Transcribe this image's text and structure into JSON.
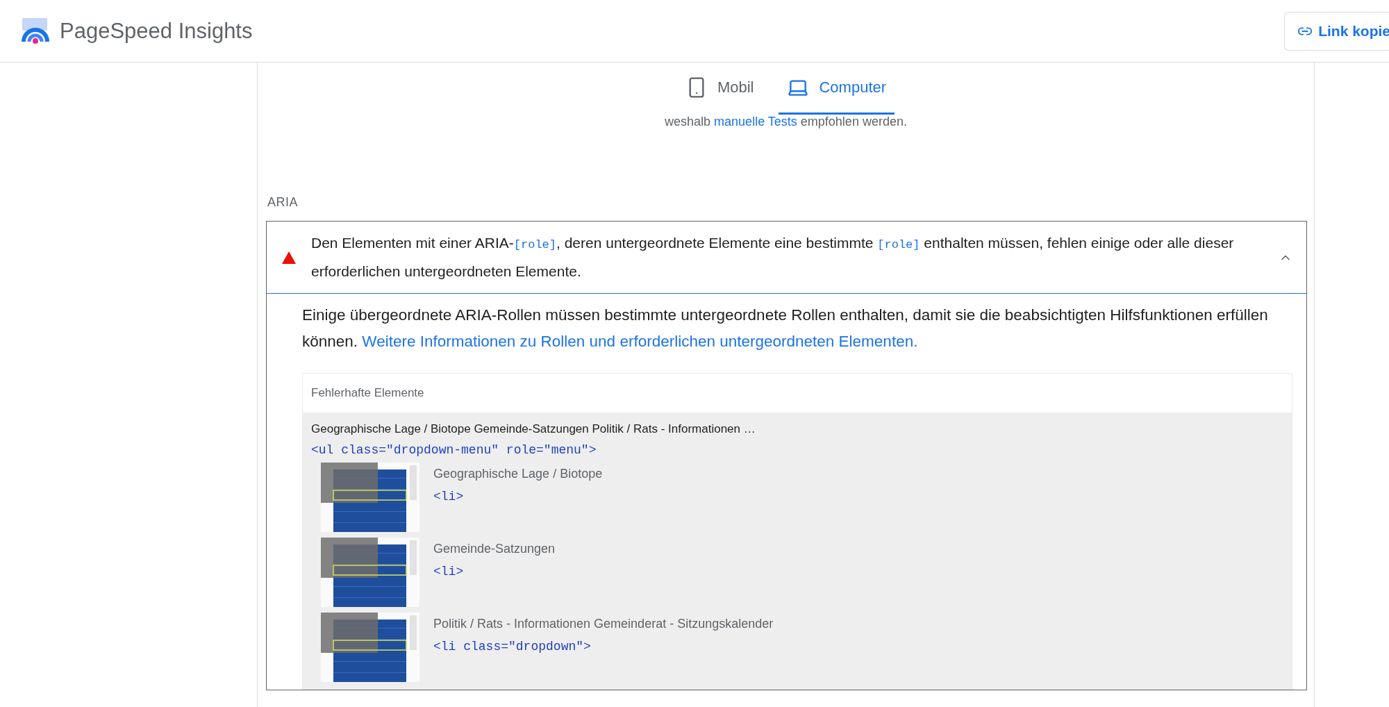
{
  "header": {
    "title": "PageSpeed Insights",
    "copy_link_button": "Link kopie"
  },
  "device_tabs": [
    {
      "label": "Mobil",
      "kind": "phone",
      "selected": false
    },
    {
      "label": "Computer",
      "kind": "laptop",
      "selected": true
    }
  ],
  "intro_text": {
    "before": "weshalb ",
    "link": "manuelle Tests",
    "after": " empfohlen werden."
  },
  "section_title": "ARIA",
  "audit": {
    "failed": true,
    "expanded": true,
    "title_parts": [
      {
        "kind": "text",
        "text": "Den Elementen mit einer ARIA-"
      },
      {
        "kind": "code",
        "text": "[role]"
      },
      {
        "kind": "text",
        "text": ", deren untergeordnete Elemente eine bestimmte "
      },
      {
        "kind": "code",
        "text": "[role]"
      },
      {
        "kind": "text",
        "text": " enthalten müssen, fehlen einige oder alle dieser erforderlichen untergeordneten Elemente."
      }
    ],
    "description": "Einige übergeordnete ARIA-Rollen müssen bestimmte untergeordnete Rollen enthalten, damit sie die beabsichtigten Hilfsfunktionen erfüllen können.",
    "learn_more_link": "Weitere Informationen zu Rollen und erforderlichen untergeordneten Elementen.",
    "table": {
      "header": "Fehlerhafte Elemente",
      "rows": [
        {
          "label": "Geographische Lage / Biotope Gemeinde-Satzungen Politik / Rats - Informationen …",
          "code": "<ul class=\"dropdown-menu\" role=\"menu\">",
          "children": [
            {
              "label": "Geographische Lage / Biotope",
              "code": "<li>"
            },
            {
              "label": "Gemeinde-Satzungen",
              "code": "<li>"
            },
            {
              "label": "Politik / Rats - Informationen Gemeinderat - Sitzungskalender",
              "code": "<li class=\"dropdown\">"
            }
          ]
        }
      ]
    }
  }
}
